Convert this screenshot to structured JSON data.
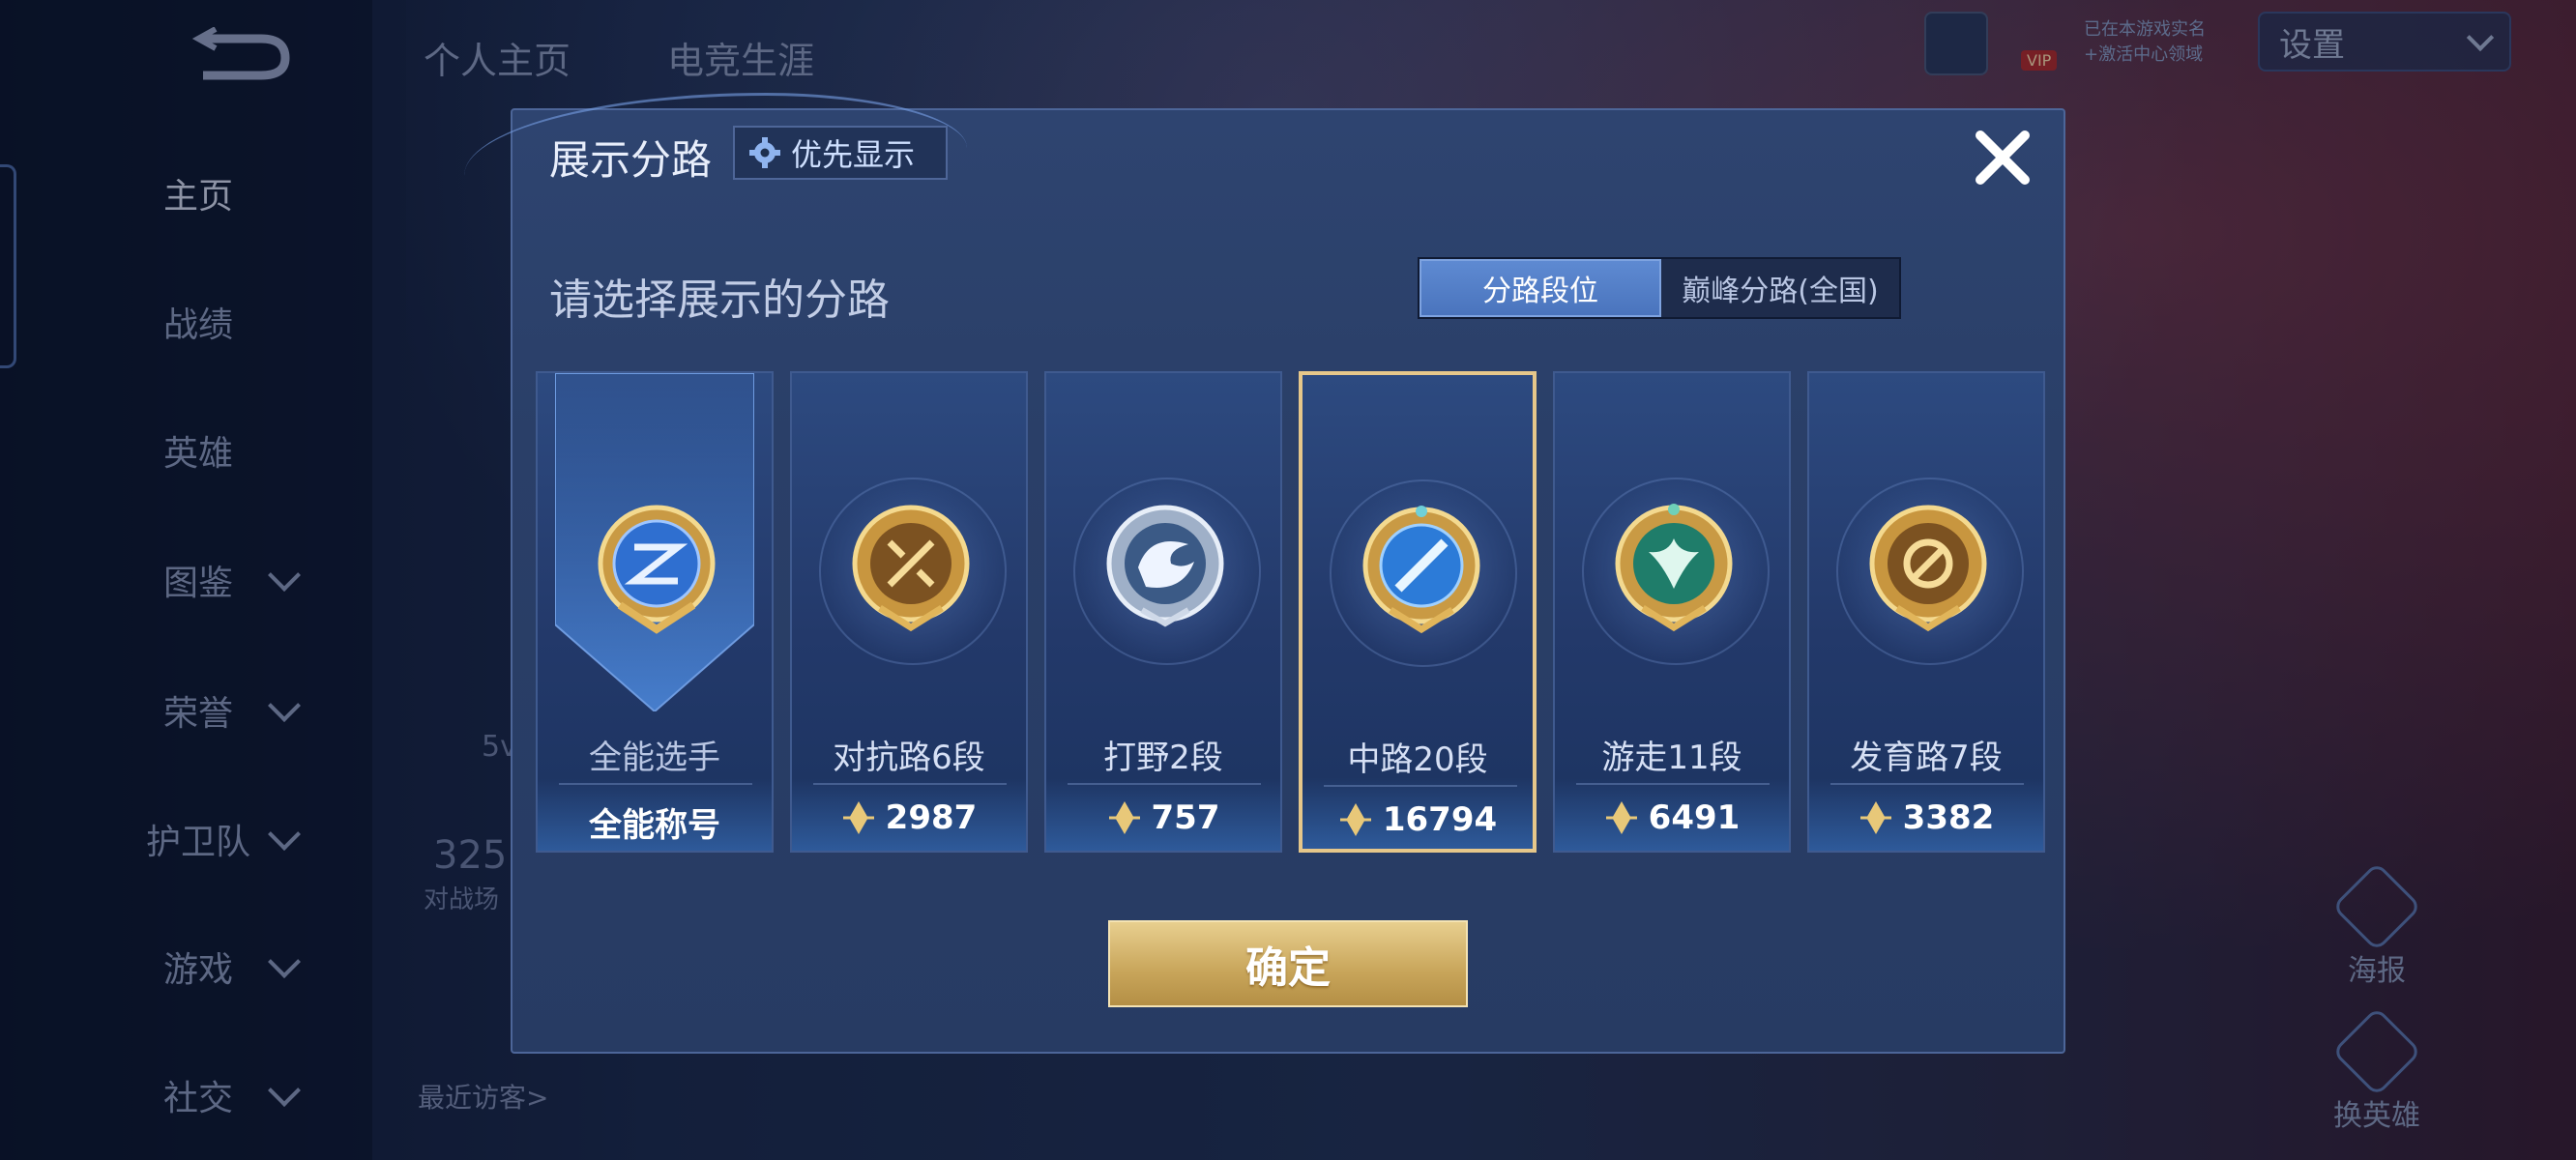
{
  "sidebar": {
    "back_icon": "back-arrow-icon",
    "items": [
      {
        "label": "主页",
        "expandable": false,
        "active": true
      },
      {
        "label": "战绩",
        "expandable": false
      },
      {
        "label": "英雄",
        "expandable": false
      },
      {
        "label": "图鉴",
        "expandable": true
      },
      {
        "label": "荣誉",
        "expandable": true
      },
      {
        "label": "护卫队",
        "expandable": true
      },
      {
        "label": "游戏",
        "expandable": true
      },
      {
        "label": "社交",
        "expandable": true
      }
    ]
  },
  "top_tabs": [
    "个人主页",
    "电竞生涯"
  ],
  "top_right": {
    "vip": "VIP",
    "mini_line1": "已在本游戏实名",
    "mini_line2": "+激活中心领域",
    "settings": "设置"
  },
  "background": {
    "recent_visitors": "最近访客>",
    "stat_value": "325",
    "stat_label": "对战场",
    "level_text": "5v",
    "poster": "海报",
    "change_hero": "换英雄"
  },
  "modal": {
    "title": "展示分路",
    "priority_button": "优先显示",
    "subtitle": "请选择展示的分路",
    "toggle": {
      "options": [
        "分路段位",
        "巅峰分路(全国)"
      ],
      "selected": 0
    },
    "cards": [
      {
        "name": "全能选手",
        "value": "全能称号",
        "badge": "all-round-badge-icon",
        "selected": false,
        "banner": true
      },
      {
        "name": "对抗路6段",
        "value": "2987",
        "badge": "clash-lane-badge-icon",
        "selected": false
      },
      {
        "name": "打野2段",
        "value": "757",
        "badge": "jungle-badge-icon",
        "selected": false
      },
      {
        "name": "中路20段",
        "value": "16794",
        "badge": "mid-lane-badge-icon",
        "selected": true
      },
      {
        "name": "游走11段",
        "value": "6491",
        "badge": "roam-badge-icon",
        "selected": false
      },
      {
        "name": "发育路7段",
        "value": "3382",
        "badge": "farm-lane-badge-icon",
        "selected": false
      }
    ],
    "confirm": "确定"
  },
  "colors": {
    "accent_gold": "#e6c78a",
    "toggle_active": "#5e8ad2",
    "modal_bg": "#2a3f68"
  }
}
